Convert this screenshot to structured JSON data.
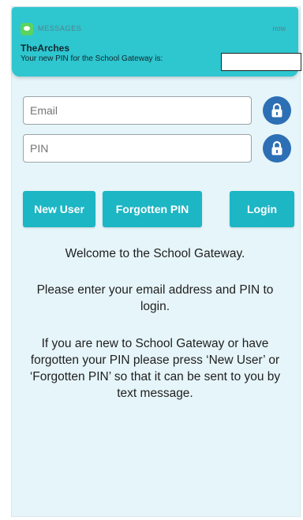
{
  "notification": {
    "app_name": "MESSAGES",
    "time": "now",
    "sender": "TheArches",
    "message": "Your new PIN for the School Gateway is:"
  },
  "form": {
    "email_placeholder": "Email",
    "pin_placeholder": "PIN"
  },
  "buttons": {
    "new_user": "New User",
    "forgotten_pin": "Forgotten PIN",
    "login": "Login"
  },
  "content": {
    "welcome": "Welcome to the School Gateway.",
    "instructions": "Please enter your email address and PIN to login.",
    "help": "If you are new to School Gateway or have forgotten your PIN please press ‘New User’ or ‘Forgotten PIN’ so that it can be sent to you by text message."
  },
  "colors": {
    "notification_bg": "#2ec6cf",
    "button_bg": "#1db6c4",
    "lock_bg": "#2d6fb4",
    "page_bg": "#e6f5fa"
  },
  "icons": [
    "messages-app-icon",
    "lock-icon"
  ]
}
